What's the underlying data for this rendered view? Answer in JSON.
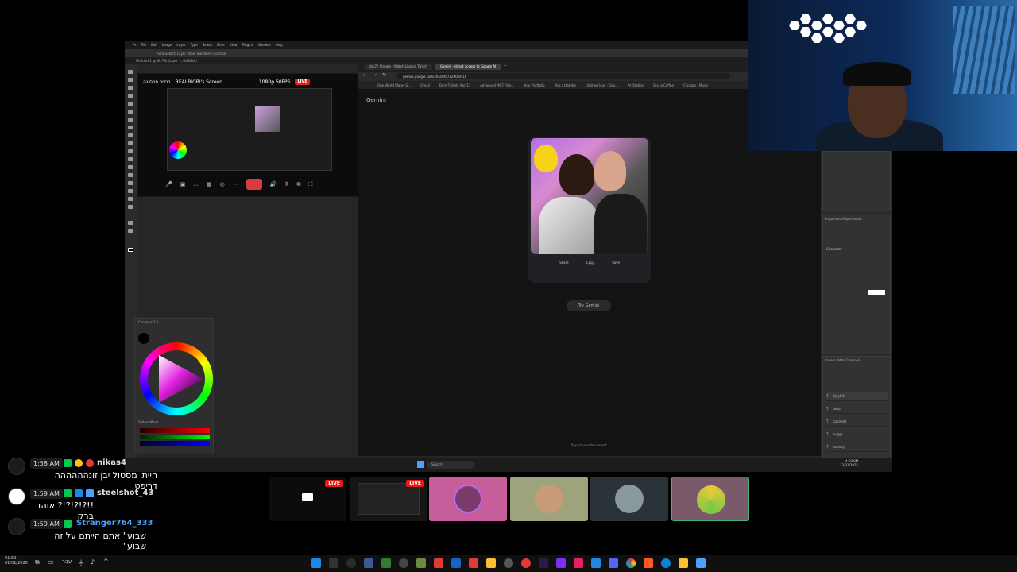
{
  "photoshop": {
    "menu": [
      "Ps",
      "File",
      "Edit",
      "Image",
      "Layer",
      "Type",
      "Select",
      "Filter",
      "View",
      "Plugins",
      "Window",
      "Help"
    ],
    "options_label": "Auto-Select:   Layer   Show Transform Controls",
    "doc_tab": "Untitled-1 @ 66.7% (Layer 1, RGB/8#)",
    "layers": [
      "Jellyfish",
      "deez",
      "cabinets",
      "nuggs",
      "society",
      "Jabba",
      "eyepic",
      "isola"
    ],
    "layer_tabs": "Layers   Paths   Channels",
    "panel_title": "Properties   Adjustments",
    "character": "Character"
  },
  "screenshare": {
    "hebrew_name": "בנדיר פרסונה",
    "title": "REALBIGBI's Screen",
    "quality": "1080p 60FPS",
    "live": "LIVE"
  },
  "colorpicker": {
    "title": "Coolorus 2.6",
    "tabs": "Sliders  Mixer"
  },
  "chrome": {
    "tabs": [
      "dry7ii Stream - Watch Live on Twitch",
      "Gemini - direct access to Google AI"
    ],
    "url": "gemini.google.com/share/fa7329004f1b",
    "bookmarks": [
      "One World Water G...",
      "Gmail",
      "Dare Tickets Apr 17",
      "Advanced MC7 Pale...",
      "Your Portfolio",
      "Plus | stat.dm",
      "Untitled Icon - Goo...",
      "ArtStation",
      "Buy a Coffee",
      "Chicago - Music"
    ],
    "page_title": "Gemini",
    "actions": [
      "Share",
      "Copy",
      "Save"
    ],
    "try_gemini": "Try Gemini",
    "report": "Report unsafe content"
  },
  "windows_inner": {
    "search": "Search",
    "time": "4:59 PM",
    "date": "12/31/2025"
  },
  "chat": [
    {
      "time": "1:58 AM",
      "user": "nikas4",
      "color": "#e6e6e6",
      "message": "הייתי מסטול יבן זונהההההה דריפט"
    },
    {
      "time": "1:59 AM",
      "user": "steelshot_43",
      "color": "#e6e6e6",
      "message": "!!?!?!?!? אוהד ברק"
    },
    {
      "time": "1:59 AM",
      "user": "Stranger764_333",
      "color": "#4aa3ff",
      "message": "שבוע\" אתם הייתם על זה שבוע\""
    }
  ],
  "participants": {
    "live": "LIVE"
  },
  "taskbar": {
    "lang": "עבר",
    "time": "01:59",
    "date": "01/01/2026"
  },
  "colors": {
    "live_red": "#e91916",
    "twitch_green": "#00c853",
    "highlight_pink": "#c75e9b"
  }
}
